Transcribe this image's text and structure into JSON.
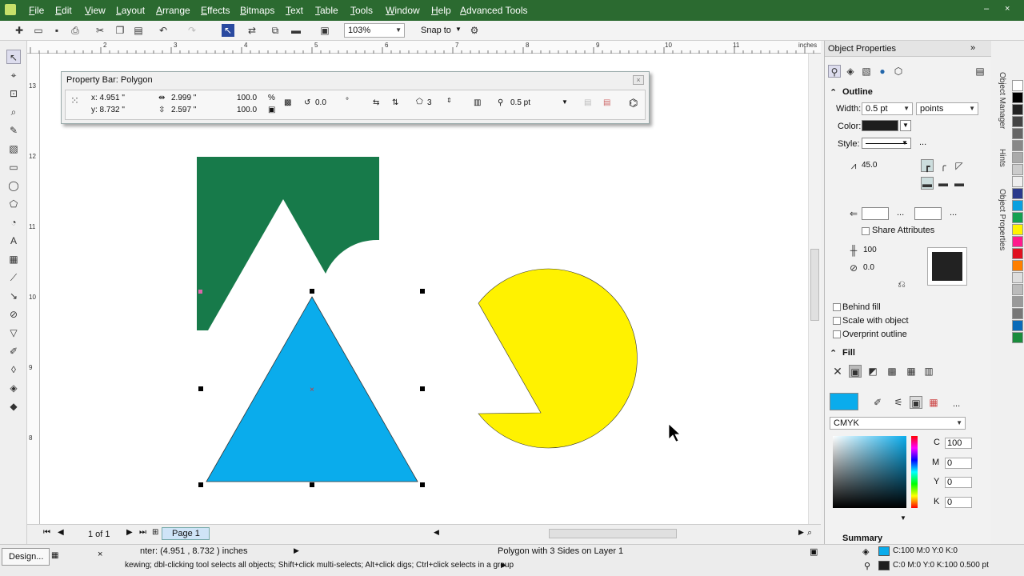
{
  "menubar": {
    "items": [
      "File",
      "Edit",
      "View",
      "Layout",
      "Arrange",
      "Effects",
      "Bitmaps",
      "Text",
      "Table",
      "Tools",
      "Window",
      "Help",
      "Advanced Tools"
    ],
    "minimize": "–",
    "close": "×"
  },
  "toolbar": {
    "zoom": "103%",
    "snap_to": "Snap to"
  },
  "ruler": {
    "units": "inches",
    "top_ticks": [
      "2",
      "3",
      "4",
      "5",
      "6",
      "7",
      "8",
      "9",
      "10",
      "11"
    ],
    "left_ticks": [
      "13",
      "12",
      "11",
      "10",
      "9",
      "8"
    ]
  },
  "propbar": {
    "title": "Property Bar: Polygon",
    "x": "x: 4.951 \"",
    "y": "y: 8.732 \"",
    "width": "2.999 \"",
    "height": "2.597 \"",
    "scale_w": "100.0",
    "scale_h": "100.0",
    "percent": "%",
    "angle": "0.0",
    "degree": "°",
    "sides": "3",
    "outline": "0.5 pt"
  },
  "shapes": {
    "green_rect_color": "#177a4a",
    "triangle_color": "#0aacec",
    "pie_color": "#fff200"
  },
  "objprops": {
    "title": "Object Properties",
    "outline_section": "Outline",
    "width_label": "Width:",
    "width_value": "0.5 pt",
    "width_unit": "points",
    "color_label": "Color:",
    "style_label": "Style:",
    "miter": "45.0",
    "share_attributes": "Share Attributes",
    "stretch": "100",
    "angle": "0.0",
    "behind_fill": "Behind fill",
    "scale_with_object": "Scale with object",
    "overprint_outline": "Overprint outline",
    "fill_section": "Fill",
    "color_model": "CMYK",
    "c_label": "C",
    "c_value": "100",
    "m_label": "M",
    "m_value": "0",
    "y_label": "Y",
    "y_value": "0",
    "k_label": "K",
    "k_value": "0",
    "summary": "Summary"
  },
  "docker_tabs": [
    "Object Manager",
    "Hints",
    "Object Properties"
  ],
  "palette": [
    "#ffffff",
    "#000000",
    "#222222",
    "#444444",
    "#666666",
    "#888888",
    "#aaaaaa",
    "#cccccc",
    "#eeeeee",
    "#2b3a8c",
    "#0aa0e0",
    "#14a050",
    "#fff200",
    "#ff1a8c",
    "#e01020",
    "#ff7f00",
    "#dddddd",
    "#bbbbbb",
    "#999999",
    "#777777",
    "#0a6ab8",
    "#1a8c3c"
  ],
  "hbar": {
    "page_counter": "1 of 1",
    "page_tab": "Page 1"
  },
  "status": {
    "workspace": "Design...",
    "cursor": "nter: (4.951 , 8.732 ) inches",
    "object_info": "Polygon with 3 Sides on Layer 1",
    "hint": "kewing; dbl-clicking tool selects all objects; Shift+click multi-selects; Alt+click digs; Ctrl+click selects in a group",
    "fill_info": "C:100 M:0 Y:0 K:0",
    "outline_info": "C:0 M:0 Y:0 K:100  0.500 pt"
  }
}
